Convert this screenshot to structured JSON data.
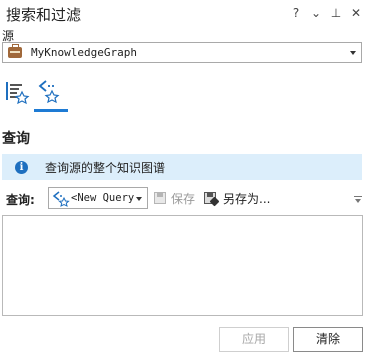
{
  "window": {
    "title": "搜索和过滤",
    "controls": {
      "help": "?",
      "menu": "⌄",
      "pin": "⊥",
      "close": "✕"
    }
  },
  "source": {
    "label": "源",
    "value": "MyKnowledgeGraph",
    "icon": "knowledge-graph-icon"
  },
  "tool_tabs": [
    {
      "icon": "search-list-icon",
      "active": false
    },
    {
      "icon": "filter-query-icon",
      "active": true
    }
  ],
  "section": {
    "title": "查询"
  },
  "info": {
    "icon": "info-icon",
    "text": "查询源的整个知识图谱"
  },
  "query": {
    "label": "查询:",
    "selected": "<New Query",
    "save_label": "保存",
    "save_as_label": "另存为..."
  },
  "footer": {
    "apply_label": "应用",
    "clear_label": "清除"
  },
  "colors": {
    "accent": "#1e7bd4",
    "info_bg": "#dceefb",
    "info_icon": "#1e6fbf"
  }
}
